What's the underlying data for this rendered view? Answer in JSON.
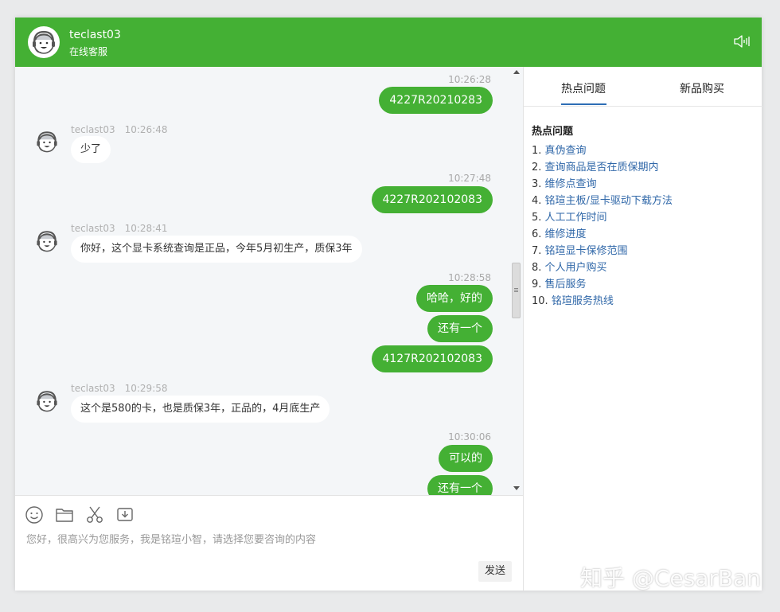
{
  "header": {
    "agent_name": "teclast03",
    "status": "在线客服",
    "colors": {
      "brand": "#44b034",
      "link": "#2f67a8",
      "tab_underline": "#2d6db5"
    }
  },
  "messages": [
    {
      "side": "user",
      "time": "10:26:28",
      "text": "4227R20210283"
    },
    {
      "side": "agent",
      "name": "teclast03",
      "time": "10:26:48",
      "text": "少了"
    },
    {
      "side": "user",
      "time": "10:27:48",
      "text": "4227R202102083"
    },
    {
      "side": "agent",
      "name": "teclast03",
      "time": "10:28:41",
      "text": "你好，这个显卡系统查询是正品，今年5月初生产，质保3年"
    },
    {
      "side": "user",
      "time": "10:28:58",
      "text": "哈哈，好的"
    },
    {
      "side": "user",
      "text": "还有一个"
    },
    {
      "side": "user",
      "text": "4127R202102083"
    },
    {
      "side": "agent",
      "name": "teclast03",
      "time": "10:29:58",
      "text": "这个是580的卡，也是质保3年，正品的，4月底生产"
    },
    {
      "side": "user",
      "time": "10:30:06",
      "text": "可以的"
    },
    {
      "side": "user",
      "text": "还有一个"
    }
  ],
  "input": {
    "tools": [
      "smiley-icon",
      "folder-icon",
      "scissors-icon",
      "download-box-icon"
    ],
    "text": "您好，很高兴为您服务，我是铭瑄小智，请选择您要咨询的内容",
    "send_label": "发送"
  },
  "sidebar": {
    "tabs": [
      {
        "label": "热点问题",
        "active": true
      },
      {
        "label": "新品购买",
        "active": false
      }
    ],
    "title": "热点问题",
    "items": [
      {
        "num": "1.",
        "label": "真伪查询"
      },
      {
        "num": "2.",
        "label": "查询商品是否在质保期内"
      },
      {
        "num": "3.",
        "label": "维修点查询"
      },
      {
        "num": "4.",
        "label": "铭瑄主板/显卡驱动下载方法"
      },
      {
        "num": "5.",
        "label": "人工工作时间"
      },
      {
        "num": "6.",
        "label": "维修进度"
      },
      {
        "num": "7.",
        "label": "铭瑄显卡保修范围"
      },
      {
        "num": "8.",
        "label": "个人用户购买"
      },
      {
        "num": "9.",
        "label": "售后服务"
      },
      {
        "num": "10.",
        "label": "铭瑄服务热线"
      }
    ]
  },
  "watermark": "知乎 @CesarBan"
}
